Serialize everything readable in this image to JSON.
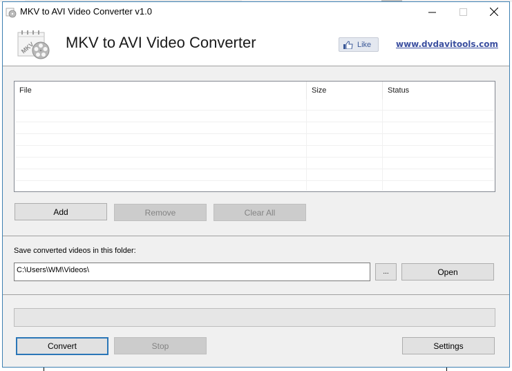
{
  "window": {
    "title": "MKV to AVI Video Converter v1.0",
    "controls": {
      "minimize": "–",
      "maximize": "□",
      "close": "✕"
    }
  },
  "header": {
    "heading": "MKV to AVI Video Converter",
    "logo_icon": "mkv-film-reel-icon",
    "like_label": "Like",
    "like_icon": "thumbs-up-icon",
    "website_link": "www.dvdavitools.com"
  },
  "file_list": {
    "columns": [
      "File",
      "Size",
      "Status"
    ],
    "rows": []
  },
  "list_buttons": {
    "add": "Add",
    "remove": "Remove",
    "clear_all": "Clear All"
  },
  "output": {
    "label": "Save converted videos in this folder:",
    "folder_value": "C:\\Users\\WM\\Videos\\",
    "browse_label": "...",
    "open_label": "Open"
  },
  "progress": {
    "value_percent": 0
  },
  "actions": {
    "convert": "Convert",
    "stop": "Stop",
    "settings": "Settings"
  },
  "colors": {
    "window_border": "#3c7fb1",
    "link": "#3b4fa0",
    "focus": "#2a76b7"
  }
}
